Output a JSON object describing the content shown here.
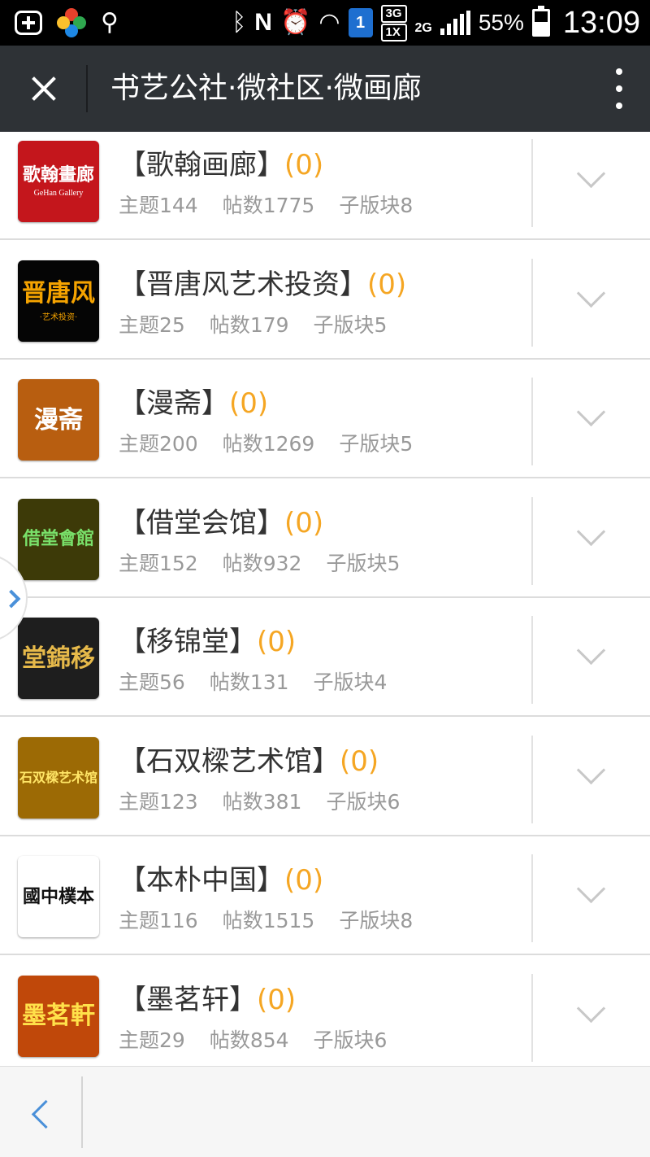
{
  "status_bar": {
    "battery_percent": "55%",
    "time": "13:09",
    "sim_badge": "1",
    "network_primary": "3G",
    "network_secondary": "1X",
    "network_tertiary": "2G",
    "battery_level": 0.55,
    "icons": [
      "plus-square-icon",
      "clover-icon",
      "usb-icon",
      "bluetooth-icon",
      "nfc-icon",
      "alarm-icon",
      "wifi-icon",
      "signal-icon",
      "battery-charging-icon"
    ]
  },
  "header": {
    "title": "书艺公社·微社区·微画廊",
    "close_icon": "close-icon",
    "more_icon": "more-vertical-icon"
  },
  "forums": [
    {
      "name": "【歌翰画廊】",
      "count": "(0)",
      "topics": "主题144",
      "posts": "帖数1775",
      "subforums": "子版块8",
      "logo": {
        "text": "歌翰畫廊",
        "subtext": "GeHan Gallery",
        "bg": "#c4161c",
        "fg": "#ffffff"
      }
    },
    {
      "name": "【晋唐风艺术投资】",
      "count": "(0)",
      "topics": "主题25",
      "posts": "帖数179",
      "subforums": "子版块5",
      "logo": {
        "text": "晋唐风",
        "subtext": "·艺术投资·",
        "bg": "#050505",
        "fg": "#f5a300"
      }
    },
    {
      "name": "【漫斋】",
      "count": "(0)",
      "topics": "主题200",
      "posts": "帖数1269",
      "subforums": "子版块5",
      "logo": {
        "text": "漫斋",
        "subtext": "",
        "bg": "#b85e10",
        "fg": "#ffffff"
      }
    },
    {
      "name": "【借堂会馆】",
      "count": "(0)",
      "topics": "主题152",
      "posts": "帖数932",
      "subforums": "子版块5",
      "logo": {
        "text": "借堂會館",
        "subtext": "",
        "bg": "#3d3a08",
        "fg": "#79e06a"
      }
    },
    {
      "name": "【移锦堂】",
      "count": "(0)",
      "topics": "主题56",
      "posts": "帖数131",
      "subforums": "子版块4",
      "logo": {
        "text": "堂錦移",
        "subtext": "",
        "bg": "#1e1e1e",
        "fg": "#e6b94a"
      }
    },
    {
      "name": "【石双樑艺术馆】",
      "count": "(0)",
      "topics": "主题123",
      "posts": "帖数381",
      "subforums": "子版块6",
      "logo": {
        "text": "石双樑艺术馆",
        "subtext": "",
        "bg": "#9c6a05",
        "fg": "#ffe566"
      }
    },
    {
      "name": "【本朴中国】",
      "count": "(0)",
      "topics": "主题116",
      "posts": "帖数1515",
      "subforums": "子版块8",
      "logo": {
        "text": "國中樸本",
        "subtext": "",
        "bg": "#ffffff",
        "fg": "#111111"
      }
    },
    {
      "name": "【墨茗轩】",
      "count": "(0)",
      "topics": "主题29",
      "posts": "帖数854",
      "subforums": "子版块6",
      "logo": {
        "text": "墨茗軒",
        "subtext": "",
        "bg": "#c0480a",
        "fg": "#ffe14a"
      }
    }
  ],
  "expand_icon": "chevron-down-icon",
  "side_handle_icon": "chevron-right-icon",
  "bottom_bar": {
    "back_icon": "chevron-left-icon"
  },
  "colors": {
    "title_bar": "#2e3236",
    "count_accent": "#f5a623",
    "stats_text": "#999999",
    "link_blue": "#4a90d9"
  }
}
